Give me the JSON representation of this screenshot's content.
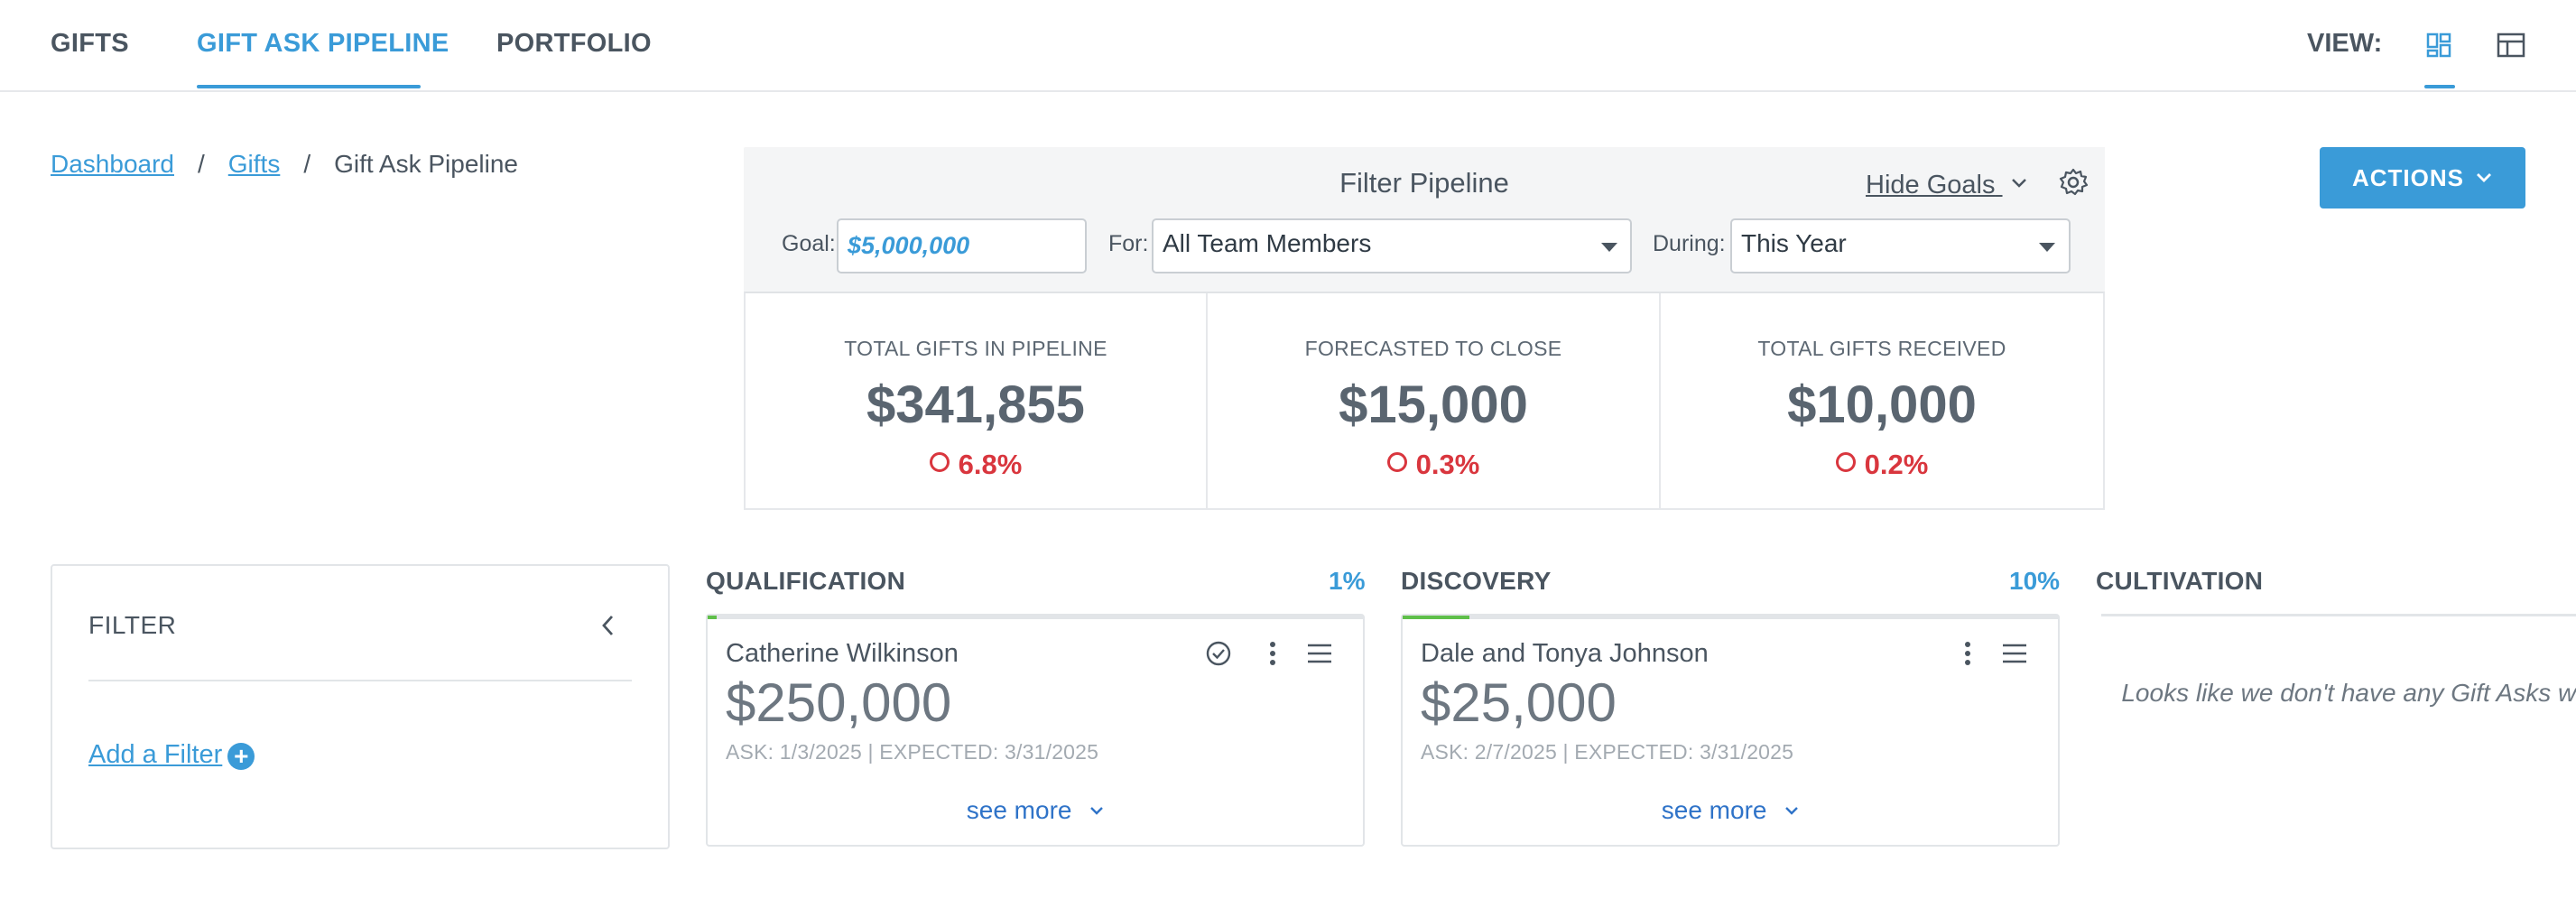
{
  "nav": {
    "tabs": [
      "GIFTS",
      "GIFT ASK PIPELINE",
      "PORTFOLIO"
    ],
    "active_tab": "GIFT ASK PIPELINE",
    "view_label": "VIEW:"
  },
  "breadcrumb": {
    "items": [
      "Dashboard",
      "Gifts",
      "Gift Ask Pipeline"
    ],
    "separator": "/"
  },
  "filter_pipeline": {
    "title": "Filter Pipeline",
    "hide_goals": "Hide Goals",
    "goal_label": "Goal:",
    "goal_value": "$5,000,000",
    "for_label": "For:",
    "for_value": "All Team Members",
    "during_label": "During:",
    "during_value": "This Year"
  },
  "stats": [
    {
      "label": "TOTAL GIFTS IN PIPELINE",
      "value": "$341,855",
      "pct": "6.8%"
    },
    {
      "label": "FORECASTED TO CLOSE",
      "value": "$15,000",
      "pct": "0.3%"
    },
    {
      "label": "TOTAL GIFTS RECEIVED",
      "value": "$10,000",
      "pct": "0.2%"
    }
  ],
  "actions_label": "ACTIONS",
  "filter_panel": {
    "title": "FILTER",
    "add_filter": "Add a Filter",
    "add_icon": "+"
  },
  "columns": [
    {
      "title": "QUALIFICATION",
      "pct": "1%",
      "progress": 0.01,
      "card": {
        "name": "Catherine Wilkinson",
        "amount": "$250,000",
        "dates": "ASK: 1/3/2025 | EXPECTED: 3/31/2025",
        "see_more": "see more"
      }
    },
    {
      "title": "DISCOVERY",
      "pct": "10%",
      "progress": 0.1,
      "card": {
        "name": "Dale and Tonya Johnson",
        "amount": "$25,000",
        "dates": "ASK: 2/7/2025 | EXPECTED: 3/31/2025",
        "see_more": "see more"
      }
    },
    {
      "title": "CULTIVATION",
      "empty_message": "Looks like we don't have any Gift Asks w status yet."
    }
  ],
  "colors": {
    "accent": "#3a9bd8",
    "negative": "#d9363e",
    "progress": "#5fbf4a",
    "link": "#2f73c8"
  }
}
